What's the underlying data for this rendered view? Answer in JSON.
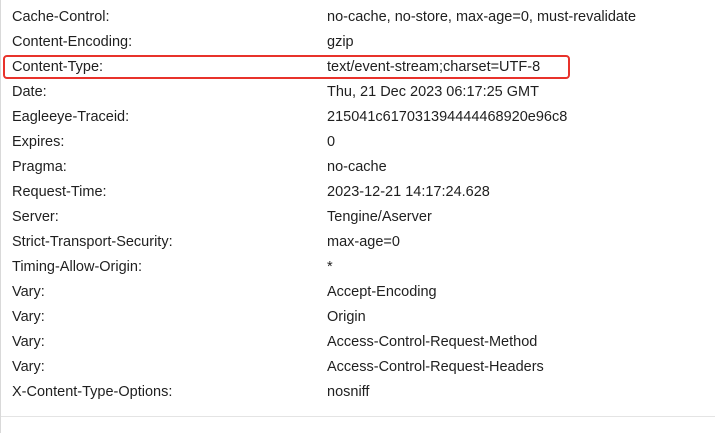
{
  "headers": [
    {
      "name": "Cache-Control:",
      "value": "no-cache, no-store, max-age=0, must-revalidate",
      "highlighted": false
    },
    {
      "name": "Content-Encoding:",
      "value": "gzip",
      "highlighted": false
    },
    {
      "name": "Content-Type:",
      "value": "text/event-stream;charset=UTF-8",
      "highlighted": true
    },
    {
      "name": "Date:",
      "value": "Thu, 21 Dec 2023 06:17:25 GMT",
      "highlighted": false
    },
    {
      "name": "Eagleeye-Traceid:",
      "value": "215041c617031394444468920e96c8",
      "highlighted": false
    },
    {
      "name": "Expires:",
      "value": "0",
      "highlighted": false
    },
    {
      "name": "Pragma:",
      "value": "no-cache",
      "highlighted": false
    },
    {
      "name": "Request-Time:",
      "value": "2023-12-21 14:17:24.628",
      "highlighted": false
    },
    {
      "name": "Server:",
      "value": "Tengine/Aserver",
      "highlighted": false
    },
    {
      "name": "Strict-Transport-Security:",
      "value": "max-age=0",
      "highlighted": false
    },
    {
      "name": "Timing-Allow-Origin:",
      "value": "*",
      "highlighted": false
    },
    {
      "name": "Vary:",
      "value": "Accept-Encoding",
      "highlighted": false
    },
    {
      "name": "Vary:",
      "value": "Origin",
      "highlighted": false
    },
    {
      "name": "Vary:",
      "value": "Access-Control-Request-Method",
      "highlighted": false
    },
    {
      "name": "Vary:",
      "value": "Access-Control-Request-Headers",
      "highlighted": false
    },
    {
      "name": "X-Content-Type-Options:",
      "value": "nosniff",
      "highlighted": false
    }
  ],
  "highlight_color": "#e8322b"
}
